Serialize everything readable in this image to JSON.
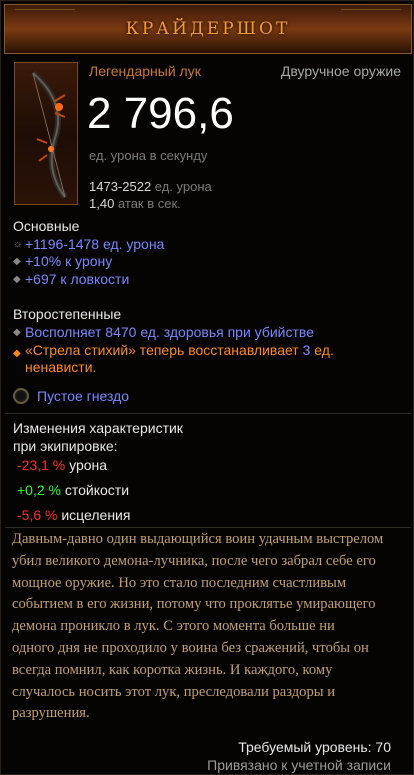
{
  "item": {
    "name": "КРАЙДЕРШОТ",
    "type": "Легендарный лук",
    "slot": "Двуручное оружие",
    "dps": "2 796,6",
    "dps_label": "ед. урона в секунду",
    "damage_range": "1473-2522",
    "damage_label": "ед. урона",
    "attack_speed": "1,40",
    "attack_speed_label": "атак в сек."
  },
  "primary": {
    "title": "Основные",
    "affixes": [
      {
        "text": "+1196-1478 ед. урона",
        "icon": "swirl-icon"
      },
      {
        "text": "+10% к урону",
        "icon": "diamond-bullet-icon"
      },
      {
        "text": "+697 к ловкости",
        "icon": "diamond-bullet-icon"
      }
    ]
  },
  "secondary": {
    "title": "Второстепенные",
    "affix1": "Восполняет 8470 ед. здоровья при убийстве",
    "legendary_pre": "«Стрела стихий» теперь восстанавливает ",
    "legendary_num": "3",
    "legendary_post": " ед.",
    "legendary_line2": "ненависти."
  },
  "socket": {
    "label": "Пустое гнездо"
  },
  "changes": {
    "title_line1": "Изменения характеристик",
    "title_line2": "при экипировке:",
    "rows": [
      {
        "value": "-23,1 %",
        "label": "урона"
      },
      {
        "value": "+0,2 %",
        "label": "стойкости"
      },
      {
        "value": "-5,6 %",
        "label": "исцеления"
      }
    ]
  },
  "flavor": [
    "Давным-давно один выдающийся воин удачным выстрелом",
    "убил великого демона-лучника, после чего забрал себе его",
    "мощное оружие. Но это стало последним счастливым",
    "событием в его жизни, потому что проклятье умирающего",
    "демона проникло в лук. С этого момента больше ни",
    "одного дня не проходило у воина без сражений, чтобы он",
    "всегда помнил, как коротка жизнь. И каждого, кому",
    "случалось носить этот лук, преследовали раздоры и",
    "разрушения."
  ],
  "footer": {
    "required_level": "Требуемый уровень: 70",
    "bound": "Привязано к учетной записи"
  },
  "colors": {
    "title": "#f09a3a",
    "item_type": "#c97a2a",
    "affix_magic": "#7a86ff",
    "legendary_affix": "#ff8a1a",
    "negative": "#ff2a2a",
    "positive": "#2aff2a",
    "flavor": "#c0a070"
  }
}
